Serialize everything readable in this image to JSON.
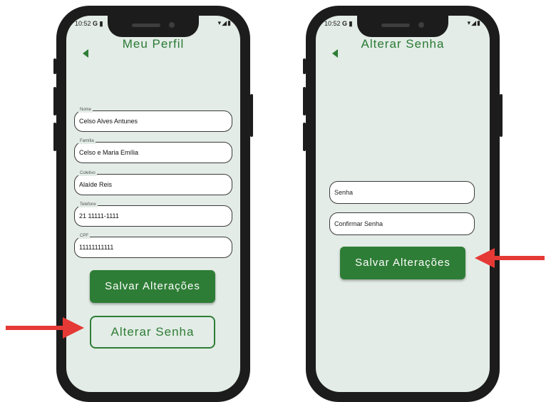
{
  "colors": {
    "accent": "#2e7d36",
    "screen_background": "#e3ece6",
    "arrow": "#e53935"
  },
  "status_bar": {
    "time": "10:52",
    "icons": "G ▮",
    "right_icons": "▾◢▮"
  },
  "profile_screen": {
    "back_icon": "back-arrow-icon",
    "title": "Meu Perfil",
    "fields": [
      {
        "label": "Nome",
        "value": "Celso Alves Antunes"
      },
      {
        "label": "Família",
        "value": "Celso e Maria Emília"
      },
      {
        "label": "Coletivo",
        "value": "Alaíde Reis"
      },
      {
        "label": "Telefone",
        "value": "21 11111-1111"
      },
      {
        "label": "CPF",
        "value": "11111111111"
      }
    ],
    "save_button": "Salvar Alterações",
    "change_password_button": "Alterar Senha"
  },
  "password_screen": {
    "back_icon": "back-arrow-icon",
    "title": "Alterar Senha",
    "password_placeholder": "Senha",
    "confirm_placeholder": "Confirmar Senha",
    "save_button": "Salvar Alterações"
  },
  "annotations": {
    "left_arrow_icon": "red-arrow-right-icon",
    "right_arrow_icon": "red-arrow-left-icon"
  }
}
